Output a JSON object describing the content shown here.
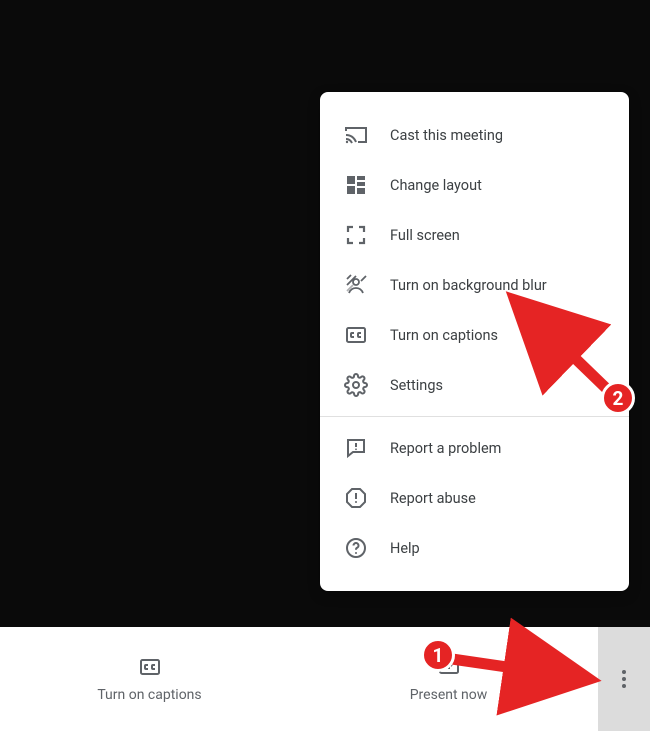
{
  "menu": {
    "items": [
      {
        "label": "Cast this meeting"
      },
      {
        "label": "Change layout"
      },
      {
        "label": "Full screen"
      },
      {
        "label": "Turn on background blur"
      },
      {
        "label": "Turn on captions"
      },
      {
        "label": "Settings"
      }
    ],
    "secondaryItems": [
      {
        "label": "Report a problem"
      },
      {
        "label": "Report abuse"
      },
      {
        "label": "Help"
      }
    ]
  },
  "bottomBar": {
    "captions": "Turn on captions",
    "present": "Present now"
  },
  "annotations": {
    "badge1": "1",
    "badge2": "2"
  }
}
